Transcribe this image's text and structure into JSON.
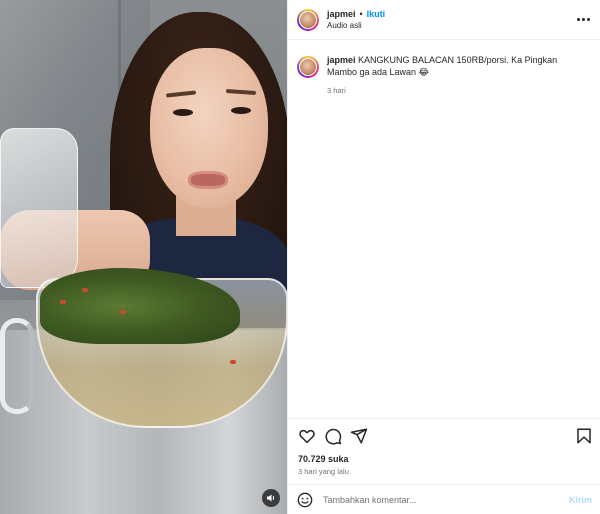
{
  "post": {
    "username": "japmei",
    "separator": "•",
    "follow_label": "Ikuti",
    "audio_label": "Audio asli"
  },
  "caption": {
    "username": "japmei",
    "text": "KANGKUNG BALACAN 150RB/porsi. Ka Pingkan Mambo ga ada Lawan 😂",
    "time": "3 hari"
  },
  "engagement": {
    "likes": "70.729 suka",
    "posted": "3 hari yang lalu"
  },
  "composer": {
    "placeholder": "Tambahkan komentar...",
    "send_label": "Kirim"
  },
  "icons": {
    "more": "more-horizontal-icon",
    "like": "heart-icon",
    "comment": "comment-icon",
    "share": "send-icon",
    "save": "bookmark-icon",
    "emoji": "emoji-icon",
    "sound": "speaker-icon"
  },
  "colors": {
    "accent": "#0095f6",
    "send_disabled": "#b3dbff",
    "muted": "#737373",
    "text": "#262626"
  }
}
